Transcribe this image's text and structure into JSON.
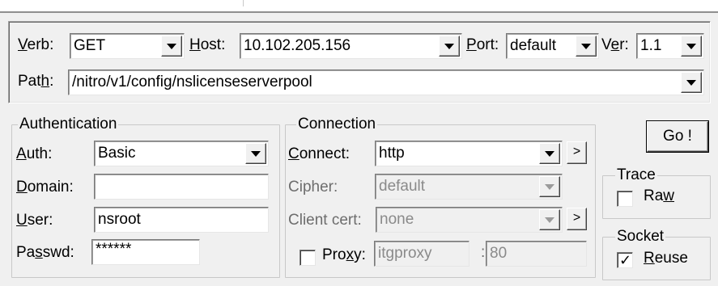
{
  "request": {
    "verb_label_pre": "",
    "verb_label_key": "V",
    "verb_label_post": "erb:",
    "verb_value": "GET",
    "host_label_key": "H",
    "host_label_post": "ost:",
    "host_value": "10.102.205.156",
    "port_label_key": "P",
    "port_label_post": "ort:",
    "port_value": "default",
    "ver_label_pre": "V",
    "ver_label_key": "e",
    "ver_label_post": "r:",
    "ver_value": "1.1",
    "path_label_pre": "Pat",
    "path_label_key": "h",
    "path_label_post": ":",
    "path_value": "/nitro/v1/config/nslicenseserverpool"
  },
  "authentication": {
    "title": "Authentication",
    "auth_label_key": "A",
    "auth_label_post": "uth:",
    "auth_value": "Basic",
    "domain_label_key": "D",
    "domain_label_post": "omain:",
    "domain_value": "",
    "user_label_key": "U",
    "user_label_post": "ser:",
    "user_value": "nsroot",
    "passwd_label_pre": "Pa",
    "passwd_label_key": "s",
    "passwd_label_post": "swd:",
    "passwd_value": "******"
  },
  "connection": {
    "title": "Connection",
    "connect_label_key": "C",
    "connect_label_post": "onnect:",
    "connect_value": "http",
    "cipher_label": "Cipher:",
    "cipher_value": "default",
    "client_cert_label": "Client cert:",
    "client_cert_value": "none",
    "proxy_label_pre": "Pro",
    "proxy_label_key": "x",
    "proxy_label_post": "y:",
    "proxy_checked": false,
    "proxy_host_value": "itgproxy",
    "proxy_colon": ":",
    "proxy_port_value": "80",
    "more_button_glyph": ">"
  },
  "go_button_label": "Go !",
  "trace": {
    "title": "Trace",
    "raw_label_pre": "Ra",
    "raw_label_key": "w",
    "raw_label_post": "",
    "raw_checked": false
  },
  "socket": {
    "title": "Socket",
    "reuse_label_pre": "",
    "reuse_label_key": "R",
    "reuse_label_post": "euse",
    "reuse_checked": true,
    "checkmark": "✓"
  }
}
